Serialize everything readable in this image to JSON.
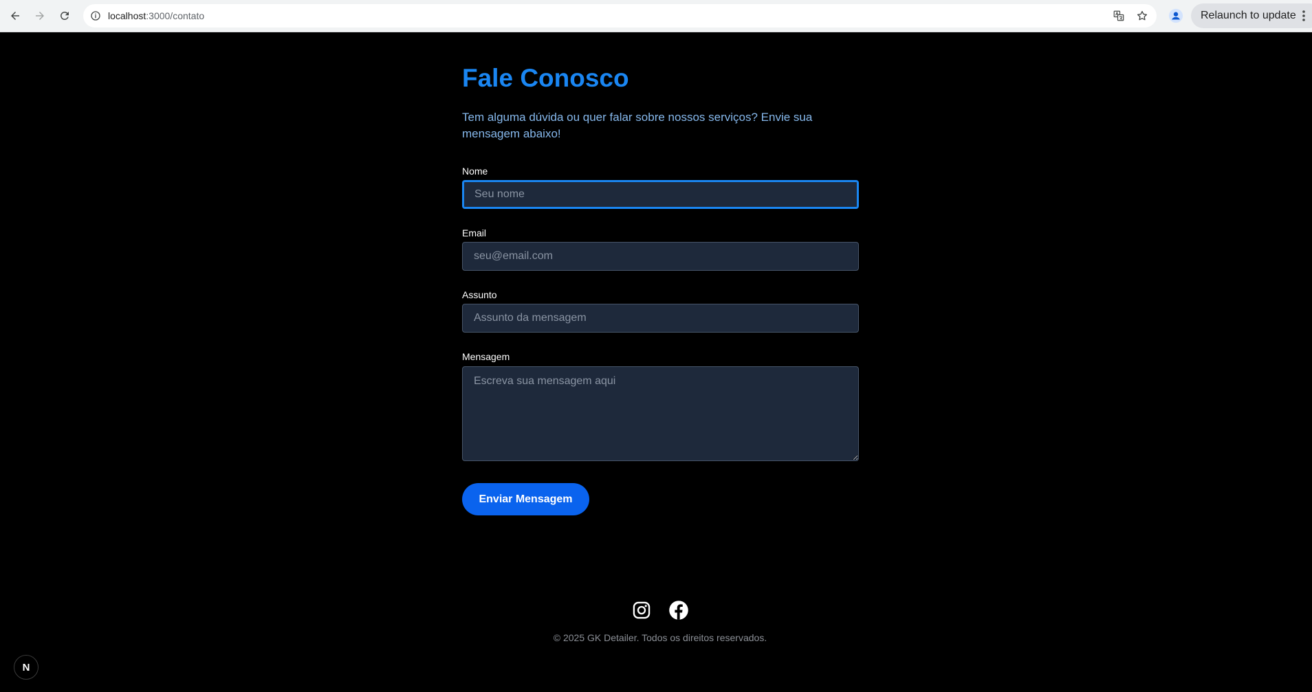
{
  "browser": {
    "url_host": "localhost",
    "url_path": ":3000/contato",
    "relaunch_label": "Relaunch to update"
  },
  "page": {
    "title": "Fale Conosco",
    "subtitle": "Tem alguma dúvida ou quer falar sobre nossos serviços? Envie sua mensagem abaixo!",
    "form": {
      "name_label": "Nome",
      "name_placeholder": "Seu nome",
      "email_label": "Email",
      "email_placeholder": "seu@email.com",
      "subject_label": "Assunto",
      "subject_placeholder": "Assunto da mensagem",
      "message_label": "Mensagem",
      "message_placeholder": "Escreva sua mensagem aqui",
      "submit_label": "Enviar Mensagem"
    },
    "footer": {
      "socials": [
        "instagram-icon",
        "facebook-icon"
      ],
      "copyright": "© 2025 GK Detailer. Todos os direitos reservados."
    },
    "dev_badge": "N"
  },
  "colors": {
    "accent": "#1a86f2",
    "button": "#0a63ee",
    "input_bg": "#1e293b",
    "background": "#000000"
  }
}
